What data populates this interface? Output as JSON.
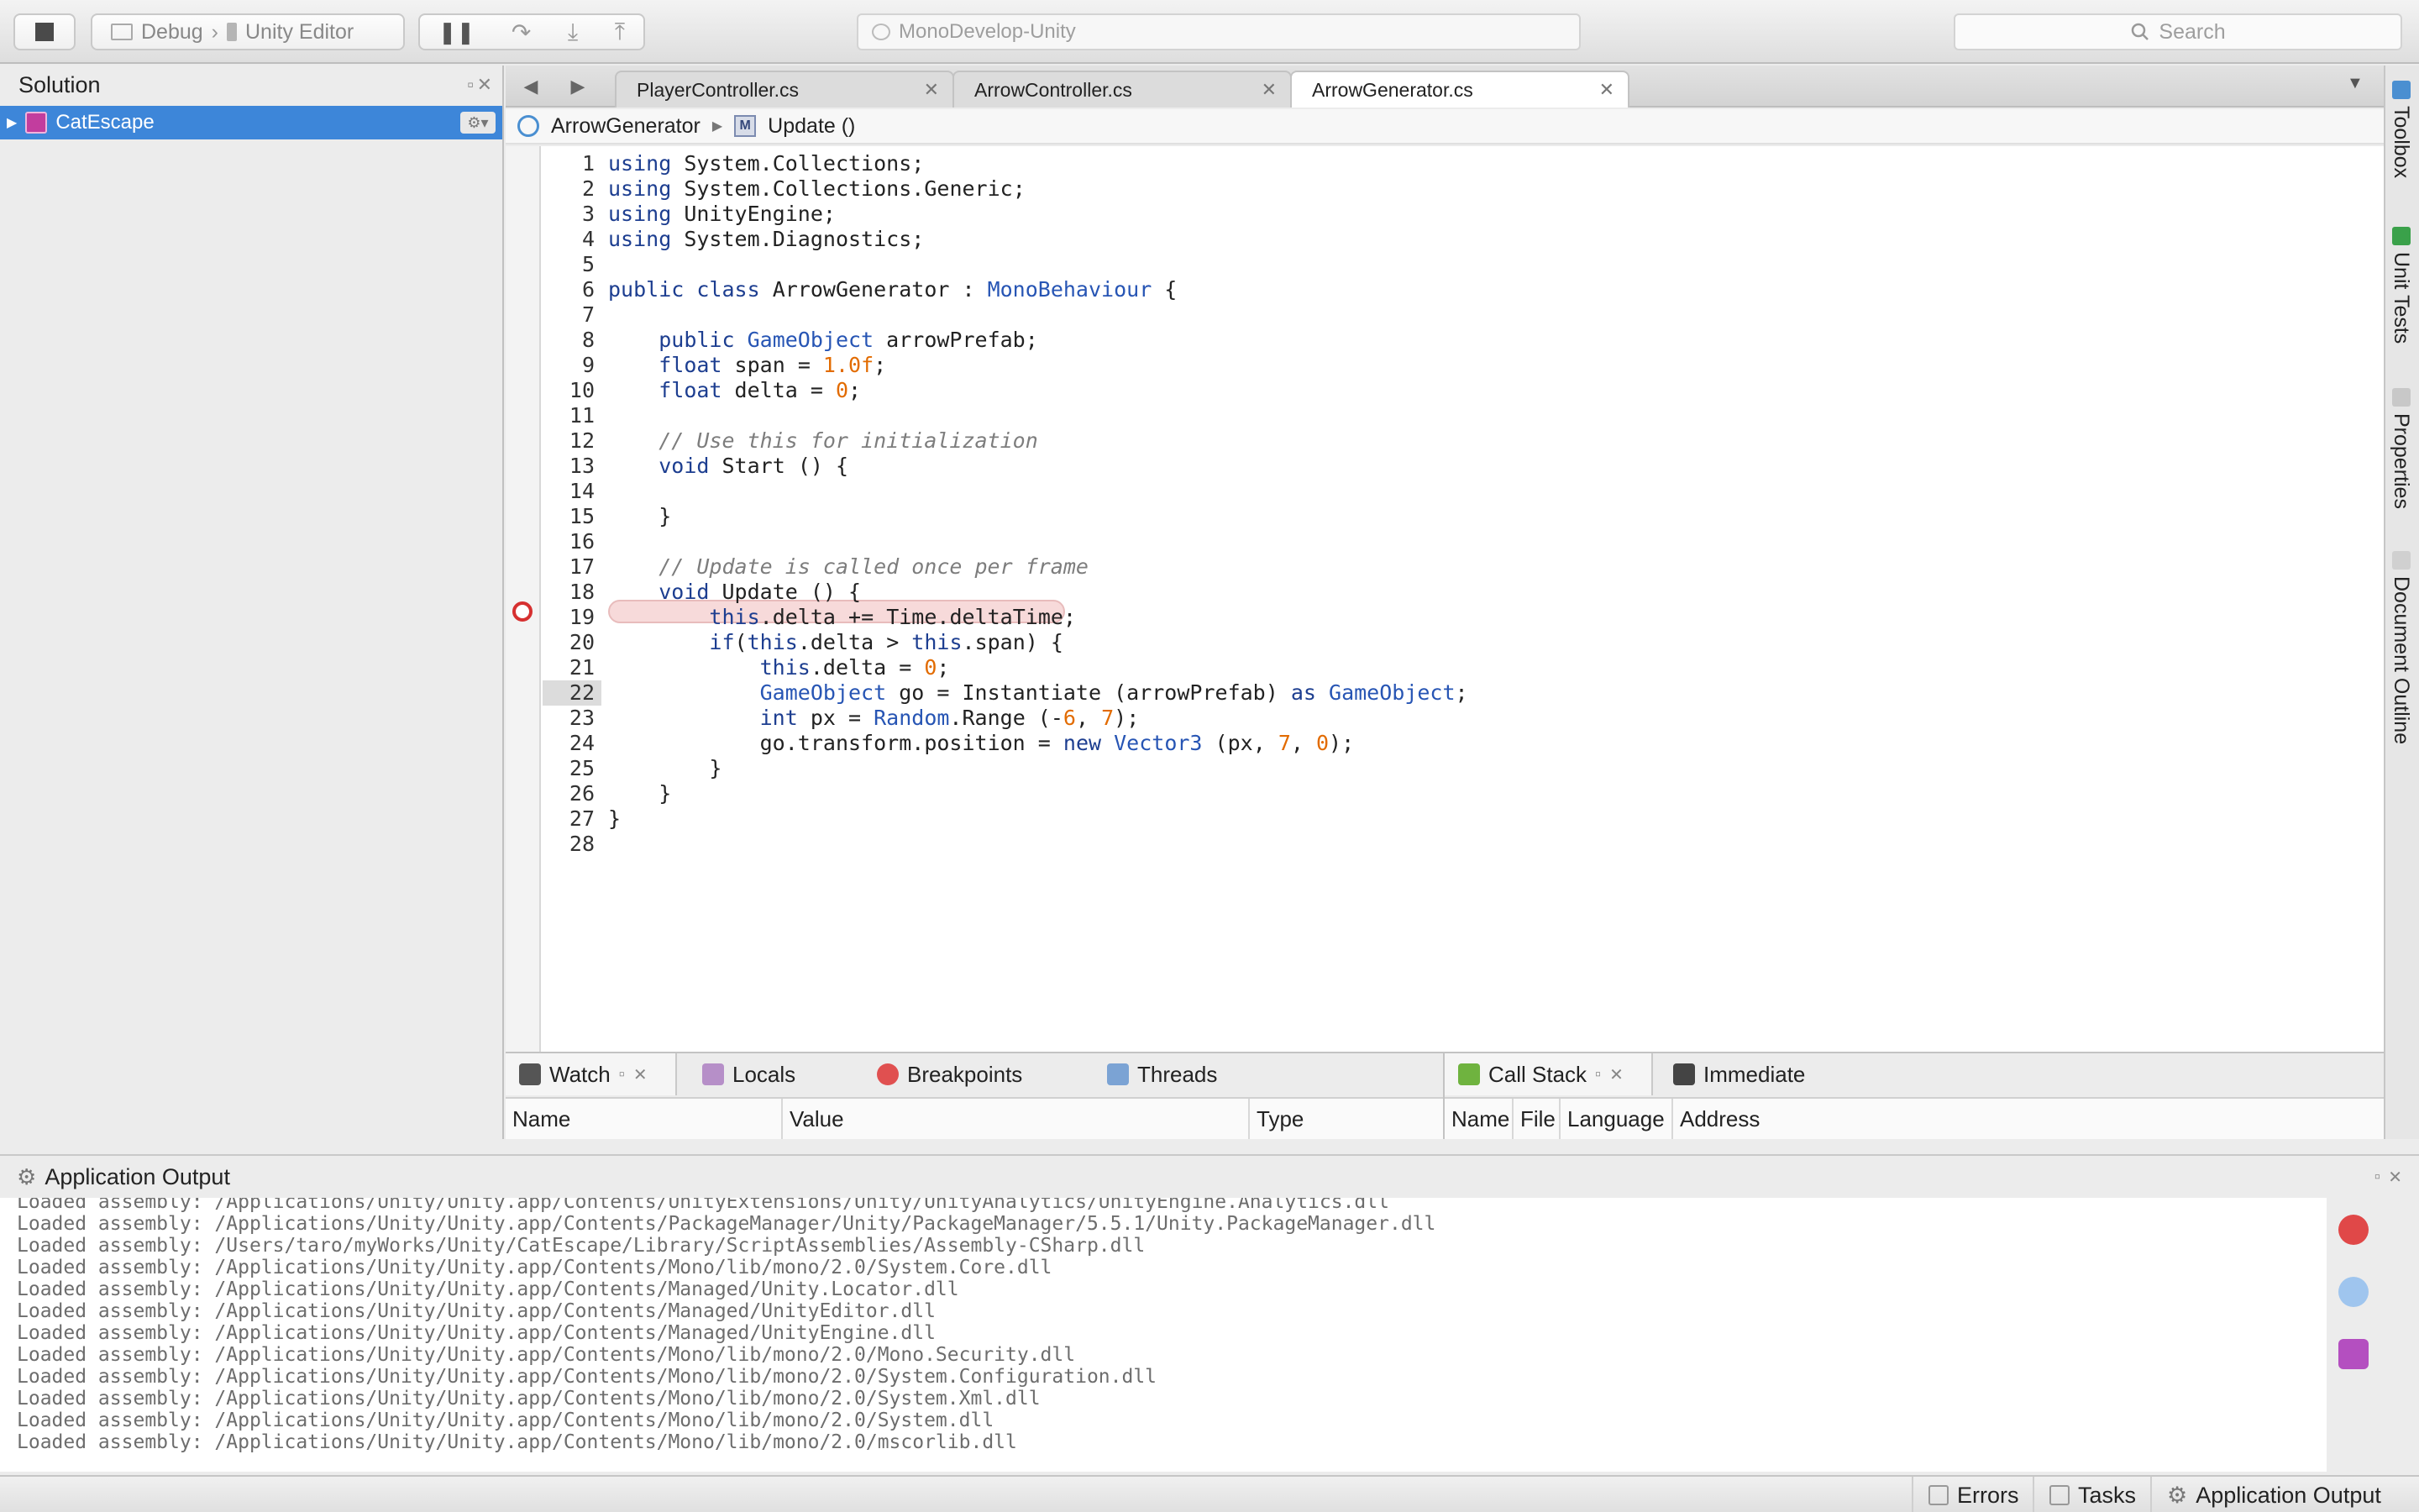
{
  "toolbar": {
    "config_label": "Debug",
    "target_label": "Unity Editor",
    "window_title": "MonoDevelop-Unity",
    "search_placeholder": "Search"
  },
  "solution": {
    "title": "Solution",
    "items": [
      {
        "label": "CatEscape"
      }
    ]
  },
  "tabs": [
    {
      "label": "PlayerController.cs",
      "active": false
    },
    {
      "label": "ArrowController.cs",
      "active": false
    },
    {
      "label": "ArrowGenerator.cs",
      "active": true
    }
  ],
  "breadcrumb": {
    "class_name": "ArrowGenerator",
    "method_name": "Update ()"
  },
  "editor": {
    "current_line": 22,
    "breakpoint_line": 19,
    "line_numbers": [
      "1",
      "2",
      "3",
      "4",
      "5",
      "6",
      "7",
      "8",
      "9",
      "10",
      "11",
      "12",
      "13",
      "14",
      "15",
      "16",
      "17",
      "18",
      "19",
      "20",
      "21",
      "22",
      "23",
      "24",
      "25",
      "26",
      "27",
      "28"
    ]
  },
  "code_lines": [
    "using System.Collections;",
    "using System.Collections.Generic;",
    "using UnityEngine;",
    "using System.Diagnostics;",
    "",
    "public class ArrowGenerator : MonoBehaviour {",
    "",
    "    public GameObject arrowPrefab;",
    "    float span = 1.0f;",
    "    float delta = 0;",
    "",
    "    // Use this for initialization",
    "    void Start () {",
    "",
    "    }",
    "",
    "    // Update is called once per frame",
    "    void Update () {",
    "        this.delta += Time.deltaTime;",
    "        if(this.delta > this.span) {",
    "            this.delta = 0;",
    "            GameObject go = Instantiate (arrowPrefab) as GameObject;",
    "            int px = Random.Range (-6, 7);",
    "            go.transform.position = new Vector3 (px, 7, 0);",
    "        }",
    "    }",
    "}",
    ""
  ],
  "debug_left": {
    "tabs": [
      {
        "label": "Watch"
      },
      {
        "label": "Locals"
      },
      {
        "label": "Breakpoints"
      },
      {
        "label": "Threads"
      }
    ],
    "columns": [
      "Name",
      "Value",
      "Type"
    ]
  },
  "debug_right": {
    "tabs": [
      {
        "label": "Call Stack"
      },
      {
        "label": "Immediate"
      }
    ],
    "columns": [
      "Name",
      "File",
      "Language",
      "Address"
    ]
  },
  "right_sidebar": {
    "items": [
      "Toolbox",
      "Unit Tests",
      "Properties",
      "Document Outline"
    ]
  },
  "output": {
    "title": "Application Output",
    "lines": [
      "Loaded assembly: /Applications/Unity/Unity.app/Contents/UnityExtensions/Unity/UnityAnalytics/UnityEngine.Analytics.dll",
      "Loaded assembly: /Applications/Unity/Unity.app/Contents/PackageManager/Unity/PackageManager/5.5.1/Unity.PackageManager.dll",
      "Loaded assembly: /Users/taro/myWorks/Unity/CatEscape/Library/ScriptAssemblies/Assembly-CSharp.dll",
      "Loaded assembly: /Applications/Unity/Unity.app/Contents/Mono/lib/mono/2.0/System.Core.dll",
      "Loaded assembly: /Applications/Unity/Unity.app/Contents/Managed/Unity.Locator.dll",
      "Loaded assembly: /Applications/Unity/Unity.app/Contents/Managed/UnityEditor.dll",
      "Loaded assembly: /Applications/Unity/Unity.app/Contents/Managed/UnityEngine.dll",
      "Loaded assembly: /Applications/Unity/Unity.app/Contents/Mono/lib/mono/2.0/Mono.Security.dll",
      "Loaded assembly: /Applications/Unity/Unity.app/Contents/Mono/lib/mono/2.0/System.Configuration.dll",
      "Loaded assembly: /Applications/Unity/Unity.app/Contents/Mono/lib/mono/2.0/System.Xml.dll",
      "Loaded assembly: /Applications/Unity/Unity.app/Contents/Mono/lib/mono/2.0/System.dll",
      "Loaded assembly: /Applications/Unity/Unity.app/Contents/Mono/lib/mono/2.0/mscorlib.dll"
    ]
  },
  "statusbar": {
    "errors_label": "Errors",
    "tasks_label": "Tasks",
    "output_label": "Application Output"
  },
  "colors": {
    "selection": "#3d86d9",
    "keyword": "#1d3e90",
    "type": "#2755b4",
    "number": "#e26b00",
    "comment": "#7d7d7d",
    "breakpoint": "#d63030"
  }
}
